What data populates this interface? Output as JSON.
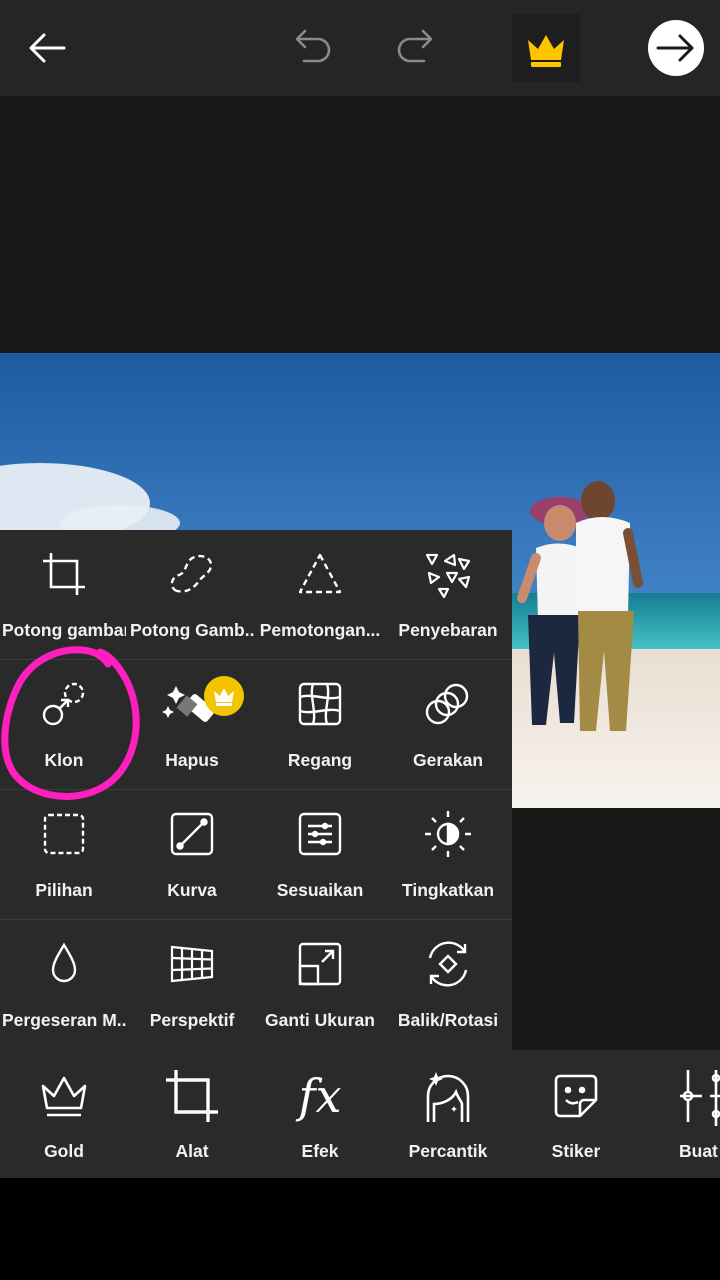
{
  "header": {
    "icons": [
      "back-arrow-icon",
      "undo-icon",
      "redo-icon",
      "crown-icon",
      "next-arrow-icon"
    ]
  },
  "tools": {
    "rows": [
      [
        {
          "label": "Potong gambar",
          "icon": "crop-icon"
        },
        {
          "label": "Potong Gamb...",
          "icon": "freecrop-icon"
        },
        {
          "label": "Pemotongan...",
          "icon": "shape-crop-icon"
        },
        {
          "label": "Penyebaran",
          "icon": "dispersion-icon"
        }
      ],
      [
        {
          "label": "Klon",
          "icon": "clone-icon"
        },
        {
          "label": "Hapus",
          "icon": "eraser-icon"
        },
        {
          "label": "Regang",
          "icon": "stretch-icon"
        },
        {
          "label": "Gerakan",
          "icon": "motion-icon"
        }
      ],
      [
        {
          "label": "Pilihan",
          "icon": "selection-icon"
        },
        {
          "label": "Kurva",
          "icon": "curves-icon"
        },
        {
          "label": "Sesuaikan",
          "icon": "adjust-icon"
        },
        {
          "label": "Tingkatkan",
          "icon": "enhance-icon"
        }
      ],
      [
        {
          "label": "Pergeseran M...",
          "icon": "drop-icon"
        },
        {
          "label": "Perspektif",
          "icon": "perspective-icon"
        },
        {
          "label": "Ganti Ukuran",
          "icon": "resize-icon"
        },
        {
          "label": "Balik/Rotasi",
          "icon": "flip-rotate-icon"
        }
      ]
    ]
  },
  "nav": {
    "items": [
      {
        "label": "Gold",
        "icon": "gold-crown-icon"
      },
      {
        "label": "Alat",
        "icon": "tools-icon"
      },
      {
        "label": "Efek",
        "icon": "fx-icon"
      },
      {
        "label": "Percantik",
        "icon": "beautify-icon"
      },
      {
        "label": "Stiker",
        "icon": "sticker-icon"
      },
      {
        "label": "Buat",
        "icon": "make-icon"
      }
    ]
  },
  "colors": {
    "annotation_circle": "#ff1fbf",
    "premium_badge": "#f5c400",
    "panel": "#2a2a2a",
    "topbar": "#252525"
  }
}
